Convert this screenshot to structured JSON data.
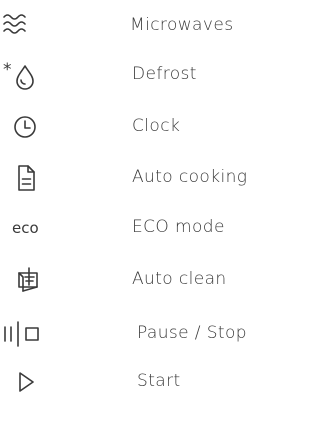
{
  "legend": {
    "items": [
      {
        "icon": "microwave-waves-icon",
        "label": "Microwaves"
      },
      {
        "icon": "defrost-icon",
        "icon_text": "*",
        "label": "Defrost"
      },
      {
        "icon": "clock-icon",
        "label": "Clock"
      },
      {
        "icon": "auto-cooking-document-icon",
        "label": "Auto cooking"
      },
      {
        "icon": "eco-text-icon",
        "icon_text": "eco",
        "label": "ECO mode"
      },
      {
        "icon": "auto-clean-icon",
        "label": "Auto clean"
      },
      {
        "icon": "pause-stop-icon",
        "label": "Pause / Stop"
      },
      {
        "icon": "play-triangle-icon",
        "label": "Start"
      }
    ]
  },
  "colors": {
    "text": "#3a3a3a",
    "background": "#ffffff"
  }
}
